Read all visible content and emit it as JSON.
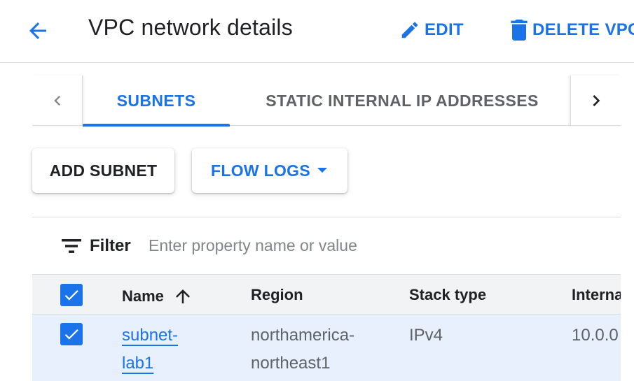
{
  "header": {
    "title": "VPC network details",
    "edit_label": "EDIT",
    "delete_label": "DELETE VPC",
    "back_icon": "arrow-back-icon",
    "edit_icon": "pencil-icon",
    "delete_icon": "trash-icon"
  },
  "tabs": [
    {
      "label": "SUBNETS",
      "active": true
    },
    {
      "label": "STATIC INTERNAL IP ADDRESSES",
      "active": false
    }
  ],
  "toolbar": {
    "add_subnet_label": "ADD SUBNET",
    "flow_logs_label": "FLOW LOGS"
  },
  "filter": {
    "label": "Filter",
    "placeholder": "Enter property name or value"
  },
  "table": {
    "columns": [
      "Name",
      "Region",
      "Stack type",
      "Interna"
    ],
    "sort_column": "Name",
    "sort_direction": "ascending",
    "rows": [
      {
        "selected": true,
        "name_line1": "subnet-",
        "name_line2": "lab1",
        "region_line1": "northamerica-",
        "region_line2": "northeast1",
        "stack_type": "IPv4",
        "internal": "10.0.0"
      }
    ]
  },
  "colors": {
    "accent": "#1a73e8",
    "selected_row": "#e8f0fe",
    "header_bg": "#f1f3f4"
  }
}
